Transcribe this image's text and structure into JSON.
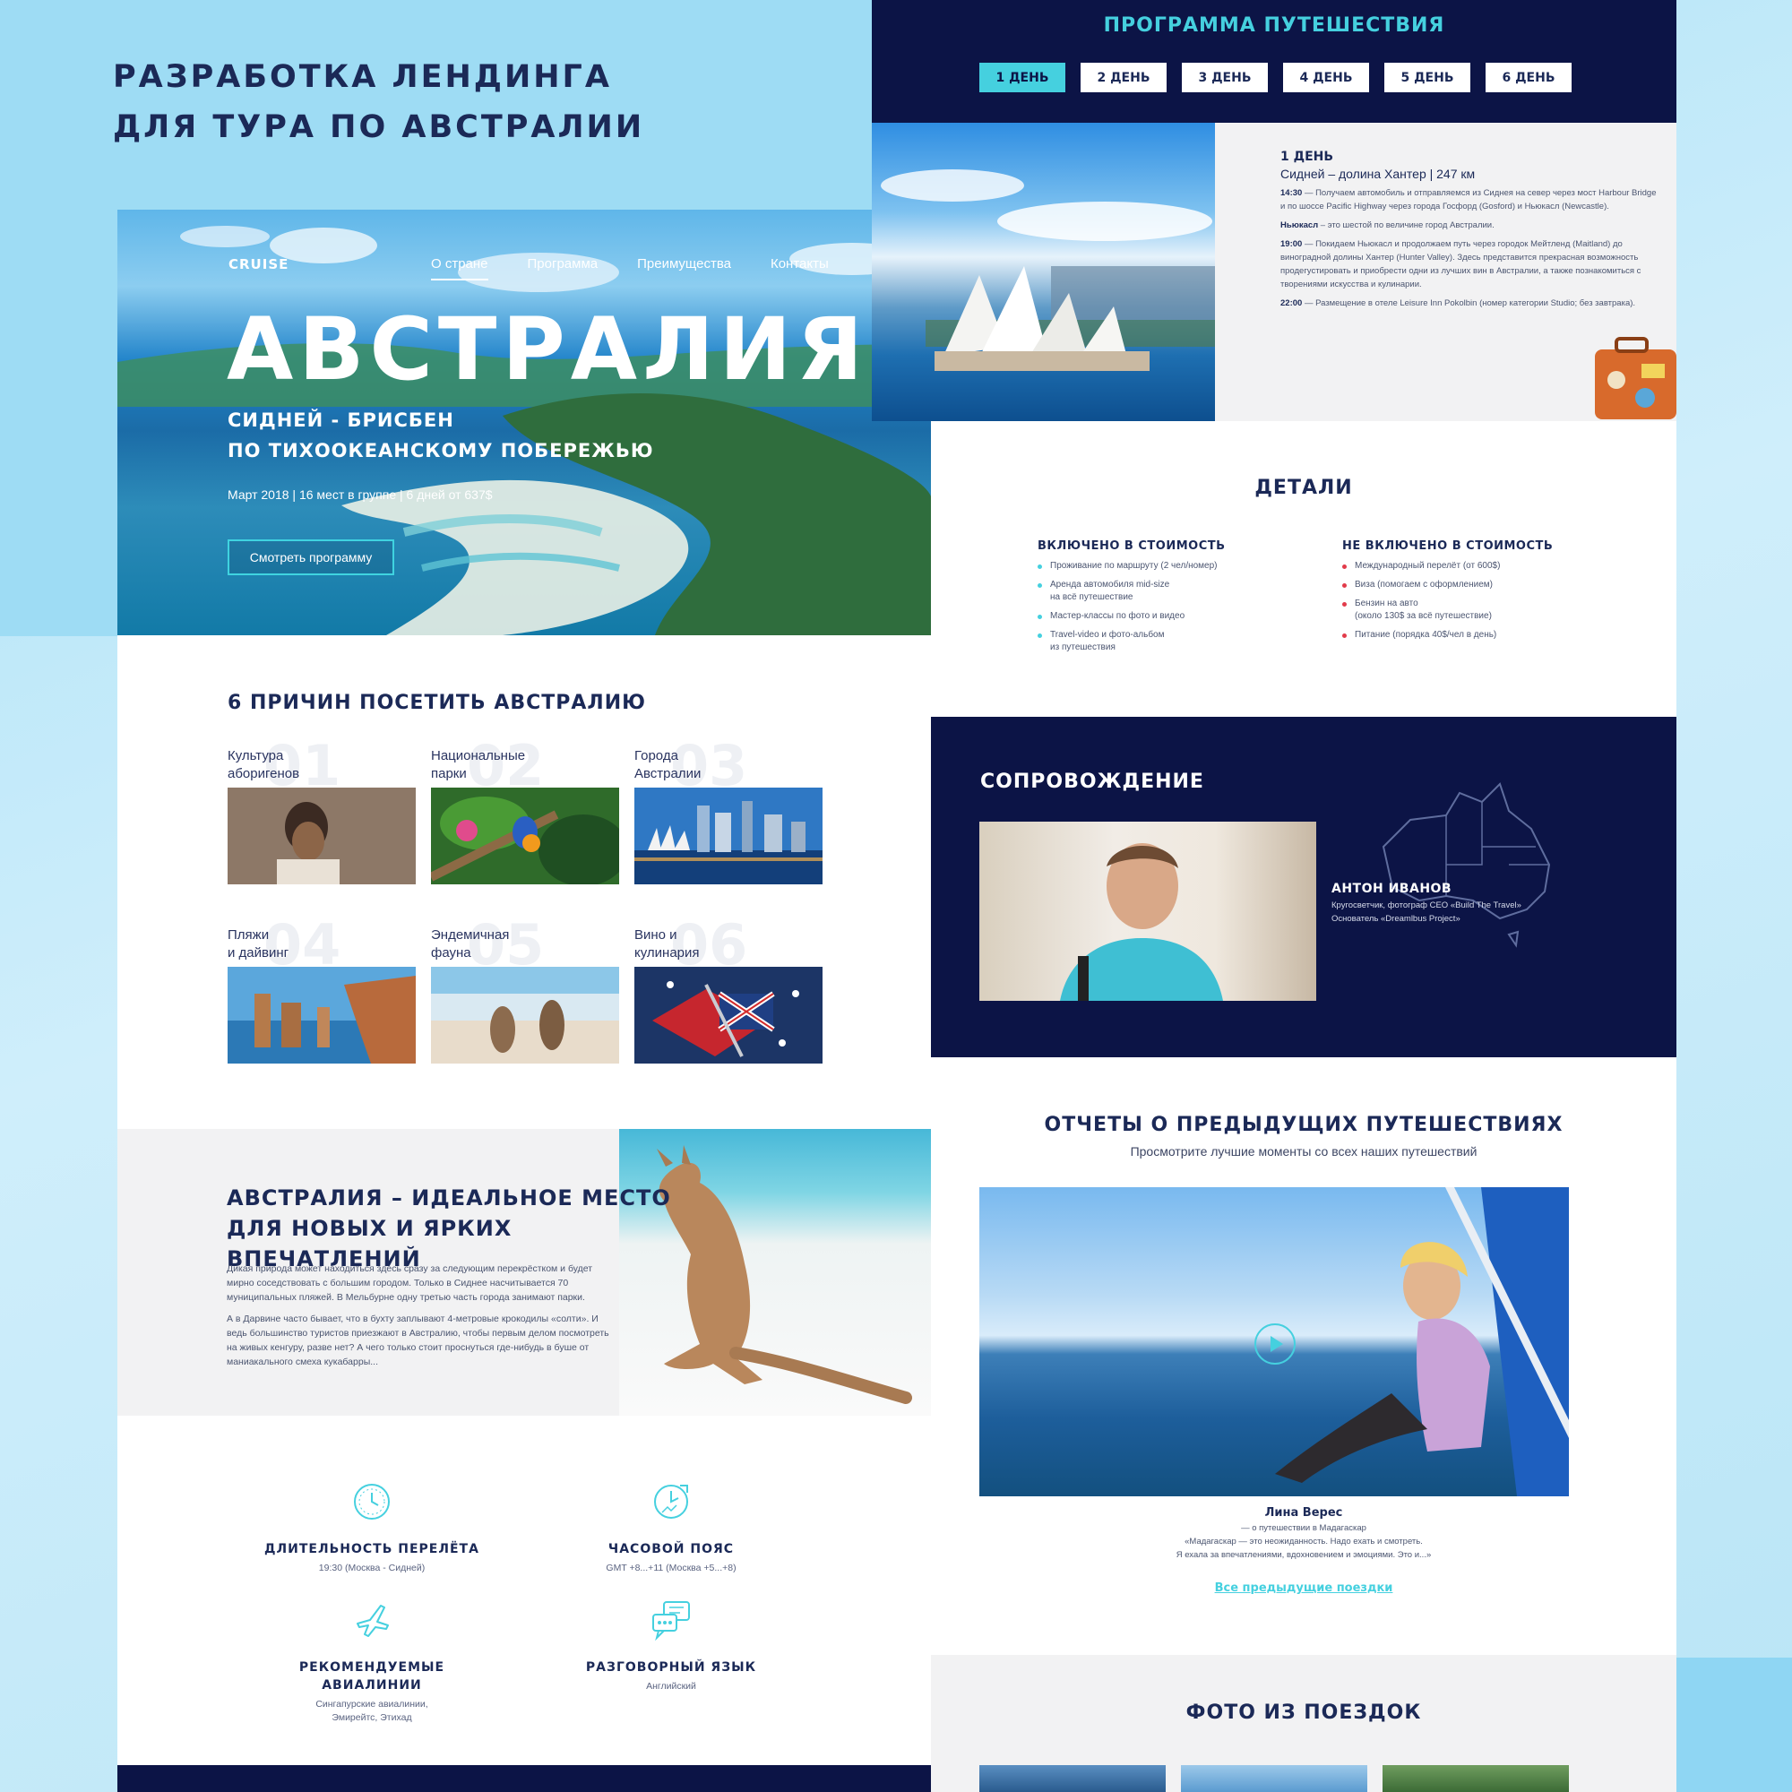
{
  "poster": {
    "title_line1": "РАЗРАБОТКА ЛЕНДИНГА",
    "title_line2": "ДЛЯ ТУРА ПО АВСТРАЛИИ"
  },
  "hero": {
    "logo": "CRUISE",
    "nav": [
      "О стране",
      "Программа",
      "Преимущества",
      "Контакты"
    ],
    "title": "АВСТРАЛИЯ",
    "subtitle_line1": "СИДНЕЙ - БРИСБЕН",
    "subtitle_line2": "ПО ТИХООКЕАНСКОМУ ПОБЕРЕЖЬЮ",
    "meta": "Март 2018 | 16 мест в группе | 6 дней от 637$",
    "cta": "Смотреть программу"
  },
  "reasons": {
    "title": "6 ПРИЧИН ПОСЕТИТЬ АВСТРАЛИЮ",
    "items": [
      {
        "num": "01",
        "label": "Культура\nаборигенов"
      },
      {
        "num": "02",
        "label": "Национальные\nпарки"
      },
      {
        "num": "03",
        "label": "Города\nАвстралии"
      },
      {
        "num": "04",
        "label": "Пляжи\nи дайвинг"
      },
      {
        "num": "05",
        "label": "Эндемичная\nфауна"
      },
      {
        "num": "06",
        "label": "Вино и\nкулинария"
      }
    ]
  },
  "ideal": {
    "title_line1": "АВСТРАЛИЯ – ИДЕАЛЬНОЕ МЕСТО",
    "title_line2": "ДЛЯ НОВЫХ И ЯРКИХ ВПЕЧАТЛЕНИЙ",
    "p1": "Дикая природа может находиться здесь сразу за следующим перекрёстком и будет мирно соседствовать с большим городом. Только в Сиднее насчитывается 70 муниципальных пляжей. В Мельбурне одну третью часть города занимают парки.",
    "p2": "А в Дарвине часто бывает, что в бухту заплывают 4-метровые крокодилы «солти». И ведь большинство туристов приезжают в Австралию, чтобы первым делом посмотреть на живых кенгуру, разве нет? А чего только стоит проснуться где-нибудь в буше от маниакального смеха кукабарры..."
  },
  "features": [
    {
      "icon": "clock-icon",
      "title": "ДЛИТЕЛЬНОСТЬ ПЕРЕЛЁТА",
      "desc": "19:30 (Москва - Сидней)"
    },
    {
      "icon": "timezone-icon",
      "title": "ЧАСОВОЙ ПОЯС",
      "desc": "GMT +8...+11 (Москва +5...+8)"
    },
    {
      "icon": "plane-icon",
      "title": "РЕКОМЕНДУЕМЫЕ\nАВИАЛИНИИ",
      "desc": "Сингапурские авиалинии,\nЭмирейтс, Этихад"
    },
    {
      "icon": "chat-icon",
      "title": "РАЗГОВОРНЫЙ ЯЗЫК",
      "desc": "Английский"
    }
  ],
  "program": {
    "title": "ПРОГРАММА ПУТЕШЕСТВИЯ",
    "days": [
      "1 ДЕНЬ",
      "2 ДЕНЬ",
      "3 ДЕНЬ",
      "4 ДЕНЬ",
      "5 ДЕНЬ",
      "6 ДЕНЬ"
    ],
    "active_day": 0,
    "day_heading": "1 ДЕНЬ",
    "route": "Сидней – долина Хантер | 247 км",
    "entries": [
      {
        "time": "14:30",
        "text": " — Получаем автомобиль и отправляемся из Сиднея на север через мост Harbour Bridge и по шоссе Pacific Highway через города Госфорд (Gosford) и Ньюкасл (Newcastle)."
      },
      {
        "time": "Ньюкасл",
        "text": " – это шестой по величине город Австралии."
      },
      {
        "time": "19:00",
        "text": " — Покидаем Ньюкасл и продолжаем путь через городок Мейтленд (Maitland) до виноградной долины Хантер (Hunter Valley). Здесь представится прекрасная возможность продегустировать и приобрести одни из лучших вин в Австралии, а также познакомиться с творениями искусства и кулинарии."
      },
      {
        "time": "22:00",
        "text": " — Размещение в отеле Leisure Inn Pokolbin (номер категории Studio; без завтрака)."
      }
    ]
  },
  "details": {
    "title": "ДЕТАЛИ",
    "included_title": "ВКЛЮЧЕНО В СТОИМОСТЬ",
    "included": [
      "Проживание по маршруту (2 чел/номер)",
      "Аренда автомобиля mid-size\nна всё путешествие",
      "Мастер-классы по фото и видео",
      "Travel-video и фото-альбом\nиз путешествия"
    ],
    "excluded_title": "НЕ ВКЛЮЧЕНО В СТОИМОСТЬ",
    "excluded": [
      "Международный перелёт (от 600$)",
      "Виза (помогаем с оформлением)",
      "Бензин на авто\n(около 130$ за всё путешествие)",
      "Питание (порядка 40$/чел в день)"
    ]
  },
  "escort": {
    "title": "СОПРОВОЖДЕНИЕ",
    "name": "АНТОН ИВАНОВ",
    "bio": "Кругосветчик, фотограф CEO «Build The Travel»\nОснователь «Dreamlbus Project»"
  },
  "reports": {
    "title": "ОТЧЕТЫ О ПРЕДЫДУЩИХ ПУТЕШЕСТВИЯХ",
    "subtitle": "Просмотрите лучшие моменты со всех наших путешествий",
    "reviewer": "Лина Верес",
    "review": "— о путешествии в Мадагаскар\n«Мадагаскар — это неожиданность. Надо ехать и смотреть.\nЯ ехала за впечатлениями, вдохновением и эмоциями. Это и...»",
    "all_link": "Все предыдущие поездки"
  },
  "photos": {
    "title": "ФОТО ИЗ ПОЕЗДОК"
  },
  "colors": {
    "navy": "#0c1446",
    "accent": "#45d0df",
    "red_bullet": "#e23b4b",
    "text": "#1b2957"
  }
}
